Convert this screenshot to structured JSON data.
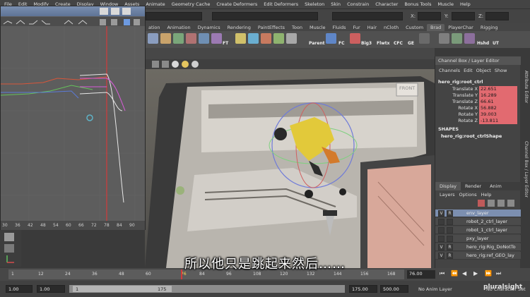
{
  "menu": [
    "File",
    "Edit",
    "Modify",
    "Create",
    "Display",
    "Window",
    "Assets",
    "Animate",
    "Geometry Cache",
    "Create Deformers",
    "Edit Deformers",
    "Skeleton",
    "Skin",
    "Constrain",
    "Character",
    "Bonus Tools",
    "Muscle",
    "Help"
  ],
  "status_fields": {
    "x_label": "X:",
    "y_label": "Y:",
    "z_label": "Z:"
  },
  "shelf_tabs": [
    "ation",
    "Animation",
    "Dynamics",
    "Rendering",
    "PaintEffects",
    "Toon",
    "Muscle",
    "Fluids",
    "Fur",
    "Hair",
    "nCloth",
    "Custom",
    "Brad",
    "PlayerChar",
    "Rigging"
  ],
  "shelf_active_tab": "Brad",
  "shelf_labels": [
    "FT",
    "Parent",
    "FC",
    "Big3",
    "Flwtx",
    "CFC",
    "GE",
    "Hshd",
    "UT"
  ],
  "graph_editor": {
    "axis_ticks": [
      "30",
      "36",
      "42",
      "48",
      "54",
      "60",
      "66",
      "72",
      "78",
      "84",
      "90"
    ]
  },
  "channel_box": {
    "title": "Channel Box / Layer Editor",
    "menu": [
      "Channels",
      "Edit",
      "Object",
      "Show"
    ],
    "node": "hero_rig:root_ctrl",
    "attributes": [
      {
        "name": "Translate X",
        "value": "22.651"
      },
      {
        "name": "Translate Y",
        "value": "16.289"
      },
      {
        "name": "Translate Z",
        "value": "66.61"
      },
      {
        "name": "Rotate X",
        "value": "56.882"
      },
      {
        "name": "Rotate Y",
        "value": "39.003"
      },
      {
        "name": "Rotate Z",
        "value": "-13.811"
      }
    ],
    "shapes_header": "SHAPES",
    "shape_node": "hero_rig:root_ctrlShape"
  },
  "side_tabs": [
    "Attribute Editor",
    "Channel Box / Layer Editor"
  ],
  "viewport": {
    "camera_label": "FRONT"
  },
  "layer_editor": {
    "tabs": [
      "Display",
      "Render",
      "Anim"
    ],
    "active_tab": "Display",
    "menu": [
      "Layers",
      "Options",
      "Help"
    ],
    "layers": [
      {
        "v": "V",
        "r": "R",
        "name": "env_layer",
        "selected": true
      },
      {
        "v": "",
        "r": "",
        "name": "robot_2_ctrl_layer",
        "selected": false
      },
      {
        "v": "",
        "r": "",
        "name": "robot_1_ctrl_layer",
        "selected": false
      },
      {
        "v": "",
        "r": "",
        "name": "pxy_layer",
        "selected": false
      },
      {
        "v": "V",
        "r": "R",
        "name": "hero_rig:Rig_DoNotTo",
        "selected": false
      },
      {
        "v": "V",
        "r": "R",
        "name": "hero_rig:ref_GEO_lay",
        "selected": false
      }
    ]
  },
  "timeline": {
    "ticks": [
      "1",
      "12",
      "24",
      "36",
      "48",
      "60",
      "76",
      "84",
      "96",
      "108",
      "120",
      "132",
      "144",
      "156",
      "168"
    ],
    "current_frame": "76.00"
  },
  "range": {
    "start": "1.00",
    "playback_start": "1.00",
    "slider_start": "1",
    "slider_end": "175",
    "playback_end": "175.00",
    "end": "500.00",
    "anim_layer": "No Anim Layer",
    "char_set": "No Character Set"
  },
  "subtitle": "所以他只是跳起来然后……",
  "watermark": "pluralsight"
}
